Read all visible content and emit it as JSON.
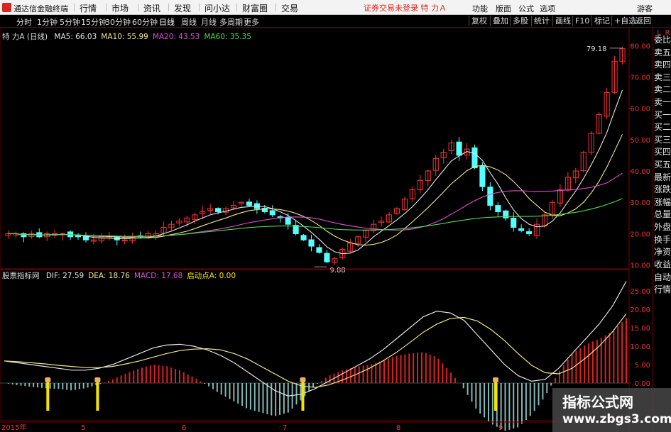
{
  "app": {
    "name": "通达信金融终端"
  },
  "menu": [
    "行情",
    "市场",
    "资讯",
    "发现",
    "问小达",
    "财富圈",
    "交易"
  ],
  "notice": "证券交易未登录  特 力Ａ",
  "right_menu": [
    "功能",
    "版面",
    "公式",
    "选项",
    "游客"
  ],
  "periods": [
    "分时",
    "1分钟",
    "5分钟",
    "15分钟",
    "30分钟",
    "60分钟",
    "日线",
    "周线",
    "月线",
    "多周期",
    "更多"
  ],
  "active_period": "日线",
  "right_tools": [
    "复权",
    "叠加",
    "多股",
    "统计",
    "画线",
    "F10",
    "标记",
    "+自选",
    "返回"
  ],
  "main_legend": {
    "name": "特 力A (日线)",
    "items": [
      {
        "label": "MA5: 66.03",
        "color": "#e6e6e6"
      },
      {
        "label": "MA10: 55.99",
        "color": "#f0e68c"
      },
      {
        "label": "MA20: 43.53",
        "color": "#e14ed9"
      },
      {
        "label": "MA60: 35.35",
        "color": "#4ddc4d"
      }
    ]
  },
  "sub_legend": {
    "name": "股票指标网",
    "items": [
      {
        "label": "DIF: 27.59",
        "color": "#e6e6e6"
      },
      {
        "label": "DEA: 18.76",
        "color": "#f0e68c"
      },
      {
        "label": "MACD: 17.68",
        "color": "#e14ed9"
      },
      {
        "label": "启动点A: 0.00",
        "color": "#f4e400"
      }
    ]
  },
  "side_panel": [
    "委比",
    "卖五",
    "卖四",
    "卖三",
    "卖二",
    "卖一",
    "买一",
    "买二",
    "买三",
    "买四",
    "买五",
    "最新",
    "涨跌",
    "涨幅",
    "总量",
    "外盘",
    "换手",
    "净资",
    "收益",
    "自动",
    "行情"
  ],
  "side_markers": [
    "L",
    "R"
  ],
  "watermark": {
    "line1": "指标公式网",
    "line2": "www.zbgs3.com"
  },
  "chart_data": [
    {
      "type": "candlestick",
      "ylim": [
        9,
        83
      ],
      "y_ticks": [
        "80.00",
        "70.00",
        "60.00",
        "50.00",
        "40.00",
        "30.00",
        "20.00",
        "10.00"
      ],
      "y_tick_values": [
        80,
        70,
        60,
        50,
        40,
        30,
        20,
        10
      ],
      "annotations": [
        {
          "label": "79.18",
          "value": 79.18,
          "kind": "high"
        },
        {
          "label": "9.88",
          "value": 9.88,
          "kind": "low"
        }
      ],
      "x_labels": [
        "2015年",
        "5",
        "6",
        "7",
        "8",
        "9"
      ],
      "close_path": [
        20,
        20,
        19,
        20,
        19,
        20,
        20,
        20,
        19,
        19,
        18,
        18,
        19,
        19,
        18,
        18,
        19,
        19,
        20,
        20,
        22,
        23,
        24,
        25,
        26,
        27,
        28,
        27,
        28,
        29,
        30,
        29,
        28,
        27,
        26,
        25,
        23,
        20,
        18,
        16,
        14,
        11,
        12,
        15,
        17,
        19,
        21,
        23,
        24,
        26,
        28,
        31,
        34,
        37,
        40,
        44,
        46,
        49,
        45,
        47,
        41,
        35,
        29,
        27,
        25,
        22,
        21,
        20,
        23,
        26,
        30,
        34,
        38,
        40,
        46,
        52,
        58,
        65,
        75,
        79
      ],
      "series": [
        {
          "name": "MA5",
          "color": "#e6e6e6"
        },
        {
          "name": "MA10",
          "color": "#f0e68c"
        },
        {
          "name": "MA20",
          "color": "#e14ed9"
        },
        {
          "name": "MA60",
          "color": "#4ddc4d"
        }
      ]
    },
    {
      "type": "macd",
      "ylim": [
        -10,
        30
      ],
      "y_ticks": [
        "25.00",
        "20.00",
        "15.00",
        "10.00",
        "5.00",
        "0.00"
      ],
      "y_tick_values": [
        25,
        20,
        15,
        10,
        5,
        0
      ],
      "series": [
        {
          "name": "DIF",
          "color": "#e6e6e6"
        },
        {
          "name": "DEA",
          "color": "#f0e68c"
        },
        {
          "name": "MACD",
          "color": "#e14ed9"
        }
      ],
      "dif_path": [
        6,
        5.5,
        5,
        4.5,
        4,
        3.5,
        3.5,
        4,
        5,
        6.5,
        8,
        9.5,
        10.3,
        10.5,
        10,
        9,
        7.5,
        5.5,
        3,
        0.5,
        -2,
        -3.5,
        -3,
        -1.5,
        0.5,
        2.5,
        4.5,
        6.5,
        9,
        12,
        15,
        18,
        19.5,
        19,
        17,
        13,
        9,
        5,
        2,
        0.5,
        1,
        4,
        8,
        12,
        16,
        21,
        27.6
      ],
      "dea_path": [
        6,
        5.8,
        5.5,
        5.2,
        4.8,
        4.5,
        4.2,
        4.2,
        4.5,
        5.2,
        6,
        7,
        8,
        8.8,
        9.2,
        9.3,
        9,
        8,
        6.5,
        4.5,
        2.5,
        0.5,
        -0.8,
        -1.2,
        -0.5,
        0.8,
        2.3,
        4,
        6,
        8.3,
        11,
        13.8,
        16,
        17.5,
        17.8,
        16.8,
        14.5,
        11.5,
        8,
        4.8,
        2.8,
        2.5,
        4,
        6.8,
        10,
        14,
        18.8
      ],
      "launch_markers": [
        0.07,
        0.15,
        0.48,
        0.79
      ]
    }
  ]
}
